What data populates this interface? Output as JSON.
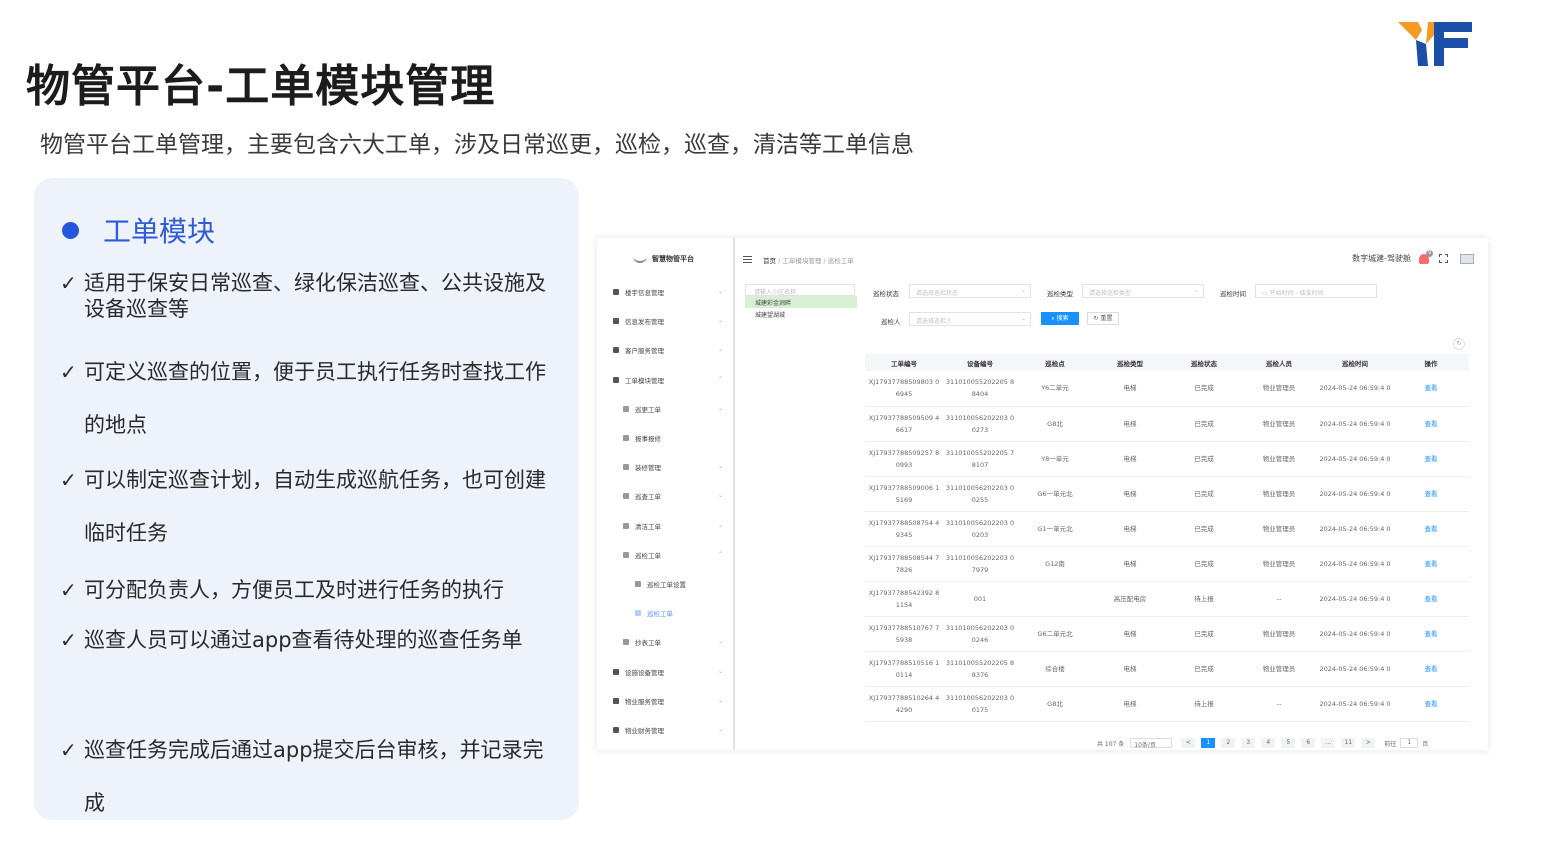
{
  "page": {
    "title": "物管平台-工单模块管理",
    "subtitle": "物管平台工单管理，主要包含六大工单，涉及日常巡更，巡检，巡查，清洁等工单信息"
  },
  "card": {
    "heading": "工单模块",
    "check": "✓",
    "items": [
      "适用于保安日常巡查、绿化保洁巡查、公共设施及设备巡查等",
      "可定义巡查的位置，便于员工执行任务时查找工作的地点",
      "可以制定巡查计划，自动生成巡航任务，也可创建临时任务",
      "可分配负责人，方便员工及时进行任务的执行",
      "巡查人员可以通过app查看待处理的巡查任务单",
      "巡查任务完成后通过app提交后台审核，并记录完成"
    ]
  },
  "colors": {
    "accent": "#2457e0",
    "card_background": "#eef2fb",
    "logo_orange": "#f59a23",
    "logo_blue": "#1b4fa8",
    "table_link": "#1890ff"
  },
  "app": {
    "name": "智慧物管平台",
    "breadcrumb": {
      "home": "首页",
      "level2": "工单模块管理",
      "level3": "巡检工单",
      "sep": "/"
    },
    "user": "数字城建-驾驶舱",
    "notification_count": "9",
    "sidebar": [
      {
        "label": "楼宇信息管理",
        "level": 0,
        "chevron": "⌄"
      },
      {
        "label": "信息发布管理",
        "level": 0,
        "chevron": "⌄"
      },
      {
        "label": "客户服务管理",
        "level": 0,
        "chevron": "⌄"
      },
      {
        "label": "工单模块管理",
        "level": 0,
        "chevron": "⌃"
      },
      {
        "label": "巡更工单",
        "level": 1,
        "chevron": "⌄"
      },
      {
        "label": "报事报修",
        "level": 1,
        "chevron": ""
      },
      {
        "label": "装修管理",
        "level": 1,
        "chevron": "⌄"
      },
      {
        "label": "巡查工单",
        "level": 1,
        "chevron": "⌄"
      },
      {
        "label": "清洁工单",
        "level": 1,
        "chevron": "⌄"
      },
      {
        "label": "巡检工单",
        "level": 1,
        "chevron": "⌃"
      },
      {
        "label": "巡检工单设置",
        "level": 2,
        "chevron": ""
      },
      {
        "label": "巡检工单",
        "level": 2,
        "chevron": "",
        "active": true
      },
      {
        "label": "抄表工单",
        "level": 1,
        "chevron": "⌄"
      },
      {
        "label": "设施设备管理",
        "level": 0,
        "chevron": "⌄"
      },
      {
        "label": "物业服务管理",
        "level": 0,
        "chevron": "⌄"
      },
      {
        "label": "物业财务管理",
        "level": 0,
        "chevron": "⌄"
      }
    ],
    "tree": {
      "placeholder": "请输入小区名称",
      "nodes": [
        "城建彩金涧畔",
        "城建望湖城"
      ]
    },
    "filters": {
      "status_label": "巡检状态",
      "status_placeholder": "请选择巡检状态",
      "type_label": "巡检类型",
      "type_placeholder": "请选择巡检类型",
      "time_label": "巡检时间",
      "time_start": "开始时间",
      "time_sep": "-",
      "time_end": "结束时间",
      "person_label": "巡检人",
      "person_placeholder": "请选择巡检人",
      "search_button": "搜索",
      "reset_button": "重置"
    },
    "table": {
      "columns": [
        "工单编号",
        "设备编号",
        "巡检点",
        "巡检类型",
        "巡检状态",
        "巡检人员",
        "巡检时间",
        "操作"
      ],
      "rows": [
        [
          "XJ17937788509803 06945",
          "311010055202205 88404",
          "Y6二单元",
          "电梯",
          "已完成",
          "物业管理员",
          "2024-05-24 06:59:4 0",
          "查看"
        ],
        [
          "XJ17937788509509 46617",
          "311010056202203 00273",
          "G8北",
          "电梯",
          "已完成",
          "物业管理员",
          "2024-05-24 06:59:4 0",
          "查看"
        ],
        [
          "XJ17937788509257 80993",
          "311010055202205 78107",
          "Y8一单元",
          "电梯",
          "已完成",
          "物业管理员",
          "2024-05-24 06:59:4 0",
          "查看"
        ],
        [
          "XJ17937788509006 15169",
          "311010056202203 00255",
          "G6一单元北",
          "电梯",
          "已完成",
          "物业管理员",
          "2024-05-24 06:59:4 0",
          "查看"
        ],
        [
          "XJ17937788508754 49345",
          "311010056202203 00203",
          "G1一单元北",
          "电梯",
          "已完成",
          "物业管理员",
          "2024-05-24 06:59:4 0",
          "查看"
        ],
        [
          "XJ17937788508544 77826",
          "311010056202203 07979",
          "G12南",
          "电梯",
          "已完成",
          "物业管理员",
          "2024-05-24 06:59:4 0",
          "查看"
        ],
        [
          "XJ17937788542392 81154",
          "001",
          "",
          "高压配电房",
          "待上报",
          "--",
          "2024-05-24 06:59:4 0",
          "查看"
        ],
        [
          "XJ17937788510767 75938",
          "311010056202203 00246",
          "G6二单元北",
          "电梯",
          "已完成",
          "物业管理员",
          "2024-05-24 06:59:4 0",
          "查看"
        ],
        [
          "XJ17937788510516 10114",
          "311010055202205 88376",
          "综合楼",
          "电梯",
          "已完成",
          "物业管理员",
          "2024-05-24 06:59:4 0",
          "查看"
        ],
        [
          "XJ17937788510264 44290",
          "311010056202203 00175",
          "G8北",
          "电梯",
          "待上报",
          "--",
          "2024-05-24 06:59:4 0",
          "查看"
        ]
      ]
    },
    "pagination": {
      "total": "共 107 条",
      "page_size": "10条/页",
      "prev": "<",
      "pages": [
        "1",
        "2",
        "3",
        "4",
        "5",
        "6",
        "...",
        "11"
      ],
      "next": ">",
      "goto": "前往",
      "current": "1",
      "unit": "页"
    }
  }
}
